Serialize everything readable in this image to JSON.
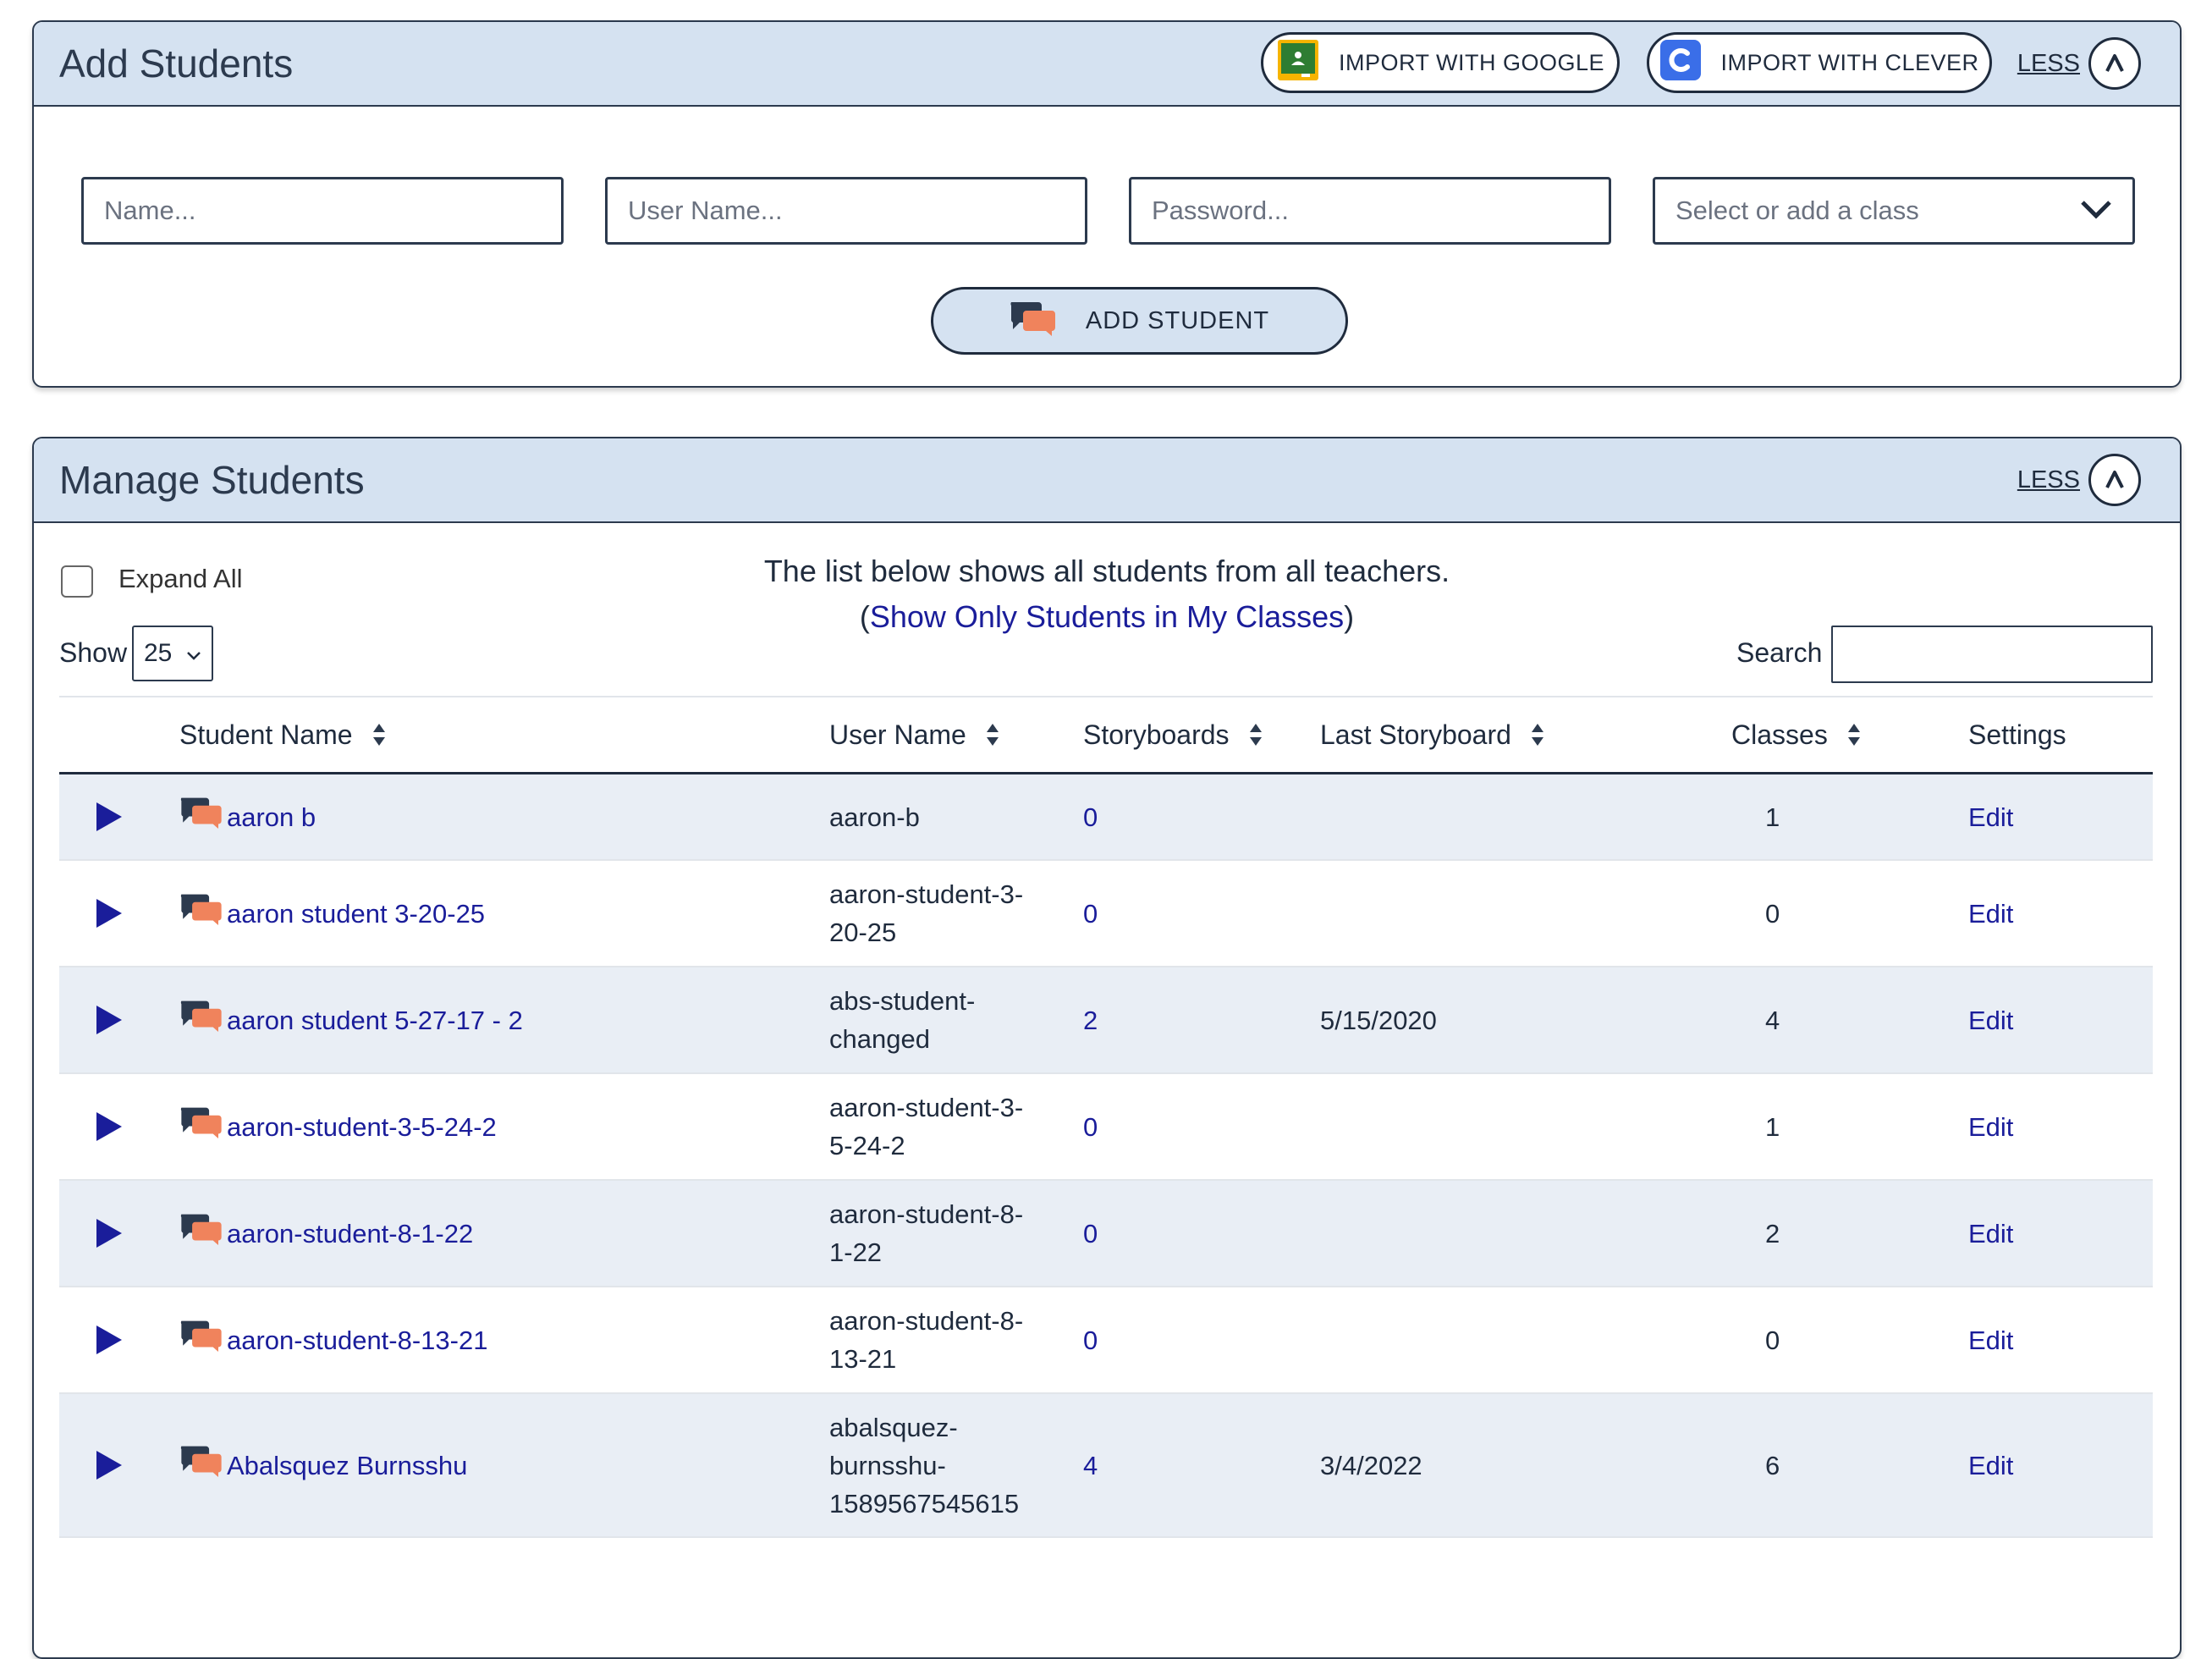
{
  "add_panel": {
    "title": "Add Students",
    "import_google_label": "IMPORT WITH GOOGLE",
    "import_clever_label": "IMPORT WITH CLEVER",
    "less_label": "LESS",
    "name_placeholder": "Name...",
    "username_placeholder": "User Name...",
    "password_placeholder": "Password...",
    "class_select_placeholder": "Select or add a class",
    "add_button_label": "ADD STUDENT"
  },
  "manage_panel": {
    "title": "Manage Students",
    "less_label": "LESS",
    "notice_line1": "The list below shows all students from all teachers.",
    "notice_link": "Show Only Students in My Classes",
    "notice_open": "(",
    "notice_close": ")",
    "expand_all_label": "Expand All",
    "show_label": "Show",
    "show_value": "25",
    "search_label": "Search",
    "search_value": ""
  },
  "table": {
    "columns": {
      "student_name": "Student Name",
      "user_name": "User Name",
      "storyboards": "Storyboards",
      "last_storyboard": "Last Storyboard",
      "classes": "Classes",
      "settings": "Settings"
    },
    "edit_label": "Edit",
    "rows": [
      {
        "name": "aaron b",
        "user_lines": [
          "aaron-b"
        ],
        "storyboards": "0",
        "last": "",
        "classes": "1"
      },
      {
        "name": "aaron student 3-20-25",
        "user_lines": [
          "aaron-student-3-",
          "20-25"
        ],
        "storyboards": "0",
        "last": "",
        "classes": "0"
      },
      {
        "name": "aaron student 5-27-17 - 2",
        "user_lines": [
          "abs-student-",
          "changed"
        ],
        "storyboards": "2",
        "last": "5/15/2020",
        "classes": "4"
      },
      {
        "name": "aaron-student-3-5-24-2",
        "user_lines": [
          "aaron-student-3-",
          "5-24-2"
        ],
        "storyboards": "0",
        "last": "",
        "classes": "1"
      },
      {
        "name": "aaron-student-8-1-22",
        "user_lines": [
          "aaron-student-8-",
          "1-22"
        ],
        "storyboards": "0",
        "last": "",
        "classes": "2"
      },
      {
        "name": "aaron-student-8-13-21",
        "user_lines": [
          "aaron-student-8-",
          "13-21"
        ],
        "storyboards": "0",
        "last": "",
        "classes": "0"
      },
      {
        "name": "Abalsquez Burnsshu",
        "user_lines": [
          "abalsquez-",
          "burnsshu-",
          "1589567545615"
        ],
        "storyboards": "4",
        "last": "3/4/2022",
        "classes": "6"
      }
    ]
  },
  "colors": {
    "header_bg": "#d5e2f1",
    "border_dark": "#2c3a4e",
    "link_blue": "#1a1d9a",
    "row_alt_bg": "#e9eef5",
    "icon_orange": "#f0835c",
    "google_green": "#2e7d32",
    "clever_blue": "#3a6ee8"
  }
}
